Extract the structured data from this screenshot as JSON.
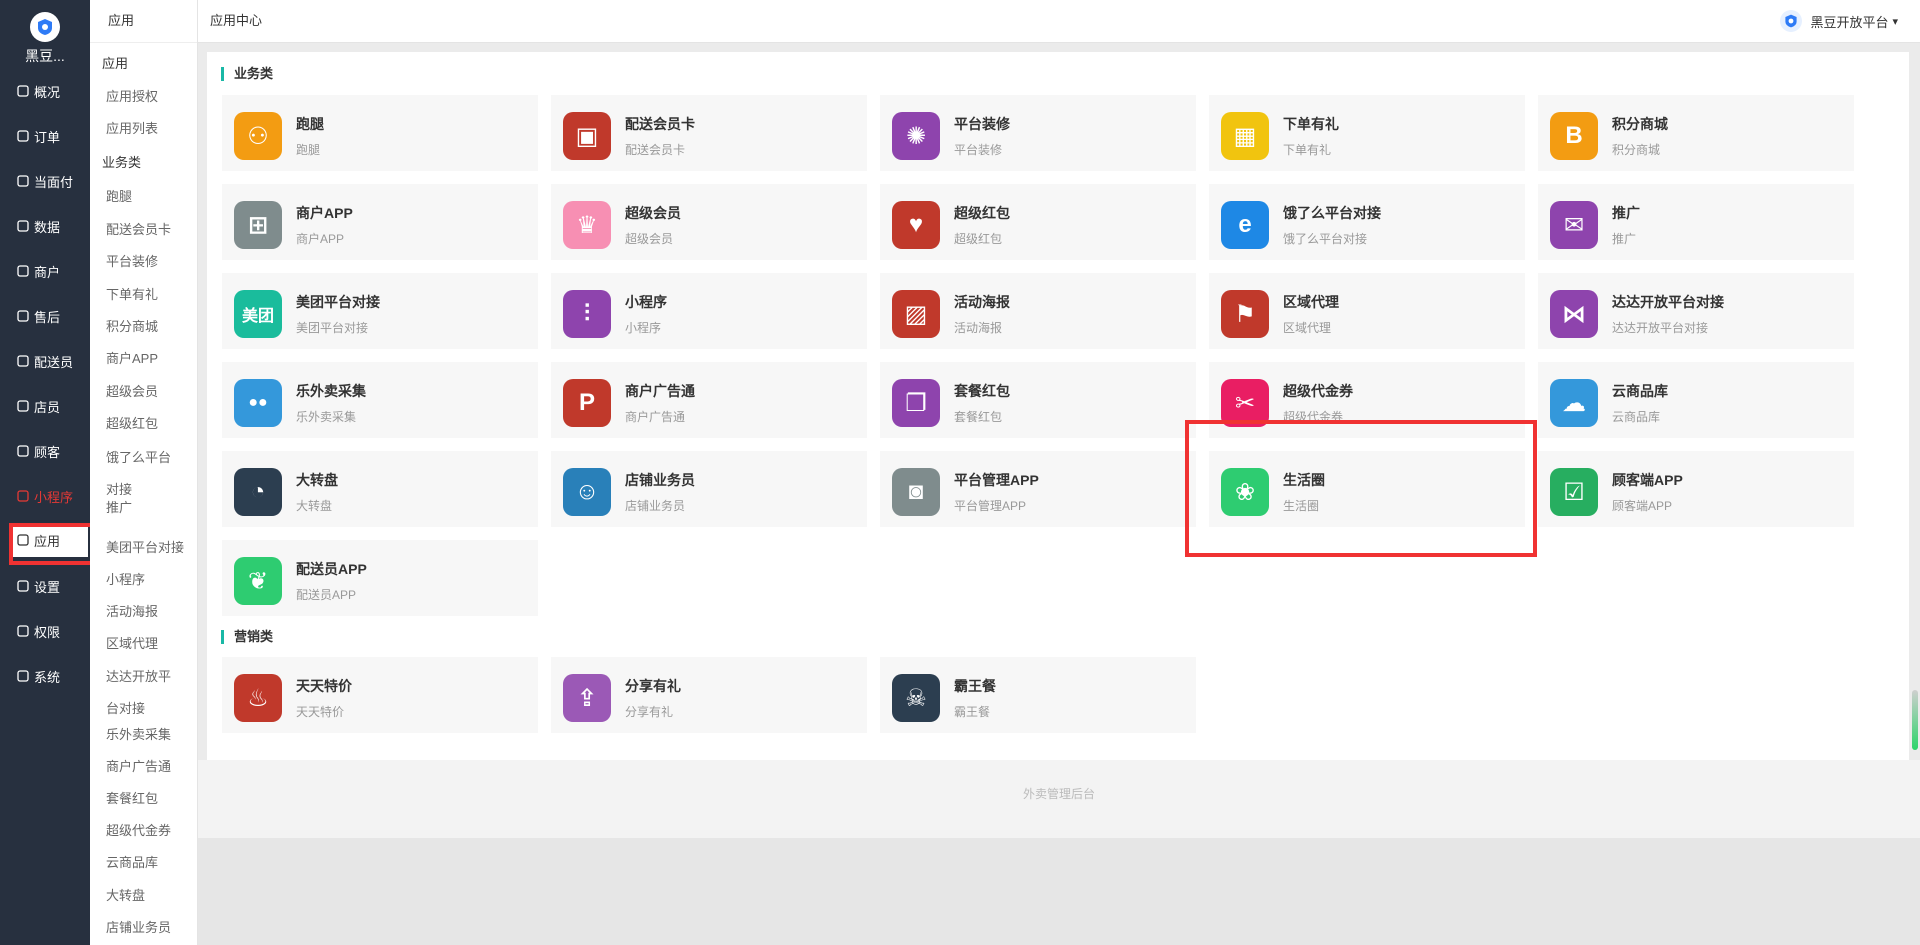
{
  "brand": {
    "name": "黑豆..."
  },
  "nav": [
    {
      "label": "概况",
      "icon": "dashboard-icon"
    },
    {
      "label": "订单",
      "icon": "order-icon"
    },
    {
      "label": "当面付",
      "icon": "pay-icon"
    },
    {
      "label": "数据",
      "icon": "chart-icon"
    },
    {
      "label": "商户",
      "icon": "shop-icon"
    },
    {
      "label": "售后",
      "icon": "aftersale-icon"
    },
    {
      "label": "配送员",
      "icon": "courier-icon"
    },
    {
      "label": "店员",
      "icon": "clerk-icon"
    },
    {
      "label": "顾客",
      "icon": "customer-icon"
    },
    {
      "label": "小程序",
      "icon": "miniprogram-icon"
    },
    {
      "label": "应用",
      "icon": "apps-icon"
    },
    {
      "label": "设置",
      "icon": "gear-icon"
    },
    {
      "label": "权限",
      "icon": "lock-icon"
    },
    {
      "label": "系统",
      "icon": "system-icon"
    }
  ],
  "subnav": {
    "header": "应用",
    "items": [
      {
        "label": "应用",
        "group": true
      },
      {
        "label": "应用授权"
      },
      {
        "label": "应用列表"
      },
      {
        "label": "业务类",
        "group": true
      },
      {
        "label": "跑腿"
      },
      {
        "label": "配送会员卡"
      },
      {
        "label": "平台装修"
      },
      {
        "label": "下单有礼"
      },
      {
        "label": "积分商城"
      },
      {
        "label": "商户APP"
      },
      {
        "label": "超级会员"
      },
      {
        "label": "超级红包"
      },
      {
        "label": "饿了么平台对接"
      },
      {
        "label": "推广"
      },
      {
        "label": "美团平台对接"
      },
      {
        "label": "小程序"
      },
      {
        "label": "活动海报"
      },
      {
        "label": "区域代理"
      },
      {
        "label": "达达开放平台对接"
      },
      {
        "label": "乐外卖采集"
      },
      {
        "label": "商户广告通"
      },
      {
        "label": "套餐红包"
      },
      {
        "label": "超级代金券"
      },
      {
        "label": "云商品库"
      },
      {
        "label": "大转盘"
      },
      {
        "label": "店铺业务员"
      }
    ]
  },
  "header": {
    "title": "应用中心",
    "user": "黑豆开放平台",
    "dropdown_glyph": "▾"
  },
  "sections": [
    {
      "title": "业务类"
    },
    {
      "title": "营销类"
    }
  ],
  "business_apps": [
    {
      "name": "跑腿",
      "desc": "跑腿",
      "color": "#f39c12",
      "icon": "runner-icon",
      "glyph": "⚇"
    },
    {
      "name": "配送会员卡",
      "desc": "配送会员卡",
      "color": "#c0392b",
      "icon": "member-card-icon",
      "glyph": "▣"
    },
    {
      "name": "平台装修",
      "desc": "平台装修",
      "color": "#8e44ad",
      "icon": "palette-icon",
      "glyph": "✺"
    },
    {
      "name": "下单有礼",
      "desc": "下单有礼",
      "color": "#f1c40f",
      "icon": "calendar-icon",
      "glyph": "▦"
    },
    {
      "name": "积分商城",
      "desc": "积分商城",
      "color": "#f39c12",
      "icon": "blogger-icon",
      "glyph": "B"
    },
    {
      "name": "商户APP",
      "desc": "商户APP",
      "color": "#7f8c8d",
      "icon": "windows-icon",
      "glyph": "⊞"
    },
    {
      "name": "超级会员",
      "desc": "超级会员",
      "color": "#f78fb3",
      "icon": "crown-icon",
      "glyph": "♛"
    },
    {
      "name": "超级红包",
      "desc": "超级红包",
      "color": "#c0392b",
      "icon": "heart-icon",
      "glyph": "♥"
    },
    {
      "name": "饿了么平台对接",
      "desc": "饿了么平台对接",
      "color": "#1e88e5",
      "icon": "eleme-icon",
      "glyph": "e"
    },
    {
      "name": "推广",
      "desc": "推广",
      "color": "#8e44ad",
      "icon": "chat-icon",
      "glyph": "✉"
    },
    {
      "name": "美团平台对接",
      "desc": "美团平台对接",
      "color": "#1abc9c",
      "icon": "meituan-icon",
      "glyph": "美团"
    },
    {
      "name": "小程序",
      "desc": "小程序",
      "color": "#8e44ad",
      "icon": "sliders-icon",
      "glyph": "⫶"
    },
    {
      "name": "活动海报",
      "desc": "活动海报",
      "color": "#c0392b",
      "icon": "image-icon",
      "glyph": "▨"
    },
    {
      "name": "区域代理",
      "desc": "区域代理",
      "color": "#c0392b",
      "icon": "flag-icon",
      "glyph": "⚑"
    },
    {
      "name": "达达开放平台对接",
      "desc": "达达开放平台对接",
      "color": "#8e44ad",
      "icon": "visualstudio-icon",
      "glyph": "⋈"
    },
    {
      "name": "乐外卖采集",
      "desc": "乐外卖采集",
      "color": "#3498db",
      "icon": "flickr-icon",
      "glyph": "●●"
    },
    {
      "name": "商户广告通",
      "desc": "商户广告通",
      "color": "#c0392b",
      "icon": "pinterest-icon",
      "glyph": "P"
    },
    {
      "name": "套餐红包",
      "desc": "套餐红包",
      "color": "#8e44ad",
      "icon": "copy-icon",
      "glyph": "❐"
    },
    {
      "name": "超级代金券",
      "desc": "超级代金券",
      "color": "#e91e63",
      "icon": "ticket-icon",
      "glyph": "✂"
    },
    {
      "name": "云商品库",
      "desc": "云商品库",
      "color": "#3498db",
      "icon": "cloud-icon",
      "glyph": "☁"
    },
    {
      "name": "大转盘",
      "desc": "大转盘",
      "color": "#2c3e50",
      "icon": "dashboard-dial-icon",
      "glyph": "◔"
    },
    {
      "name": "店铺业务员",
      "desc": "店铺业务员",
      "color": "#2980b9",
      "icon": "user-icon",
      "glyph": "☺"
    },
    {
      "name": "平台管理APP",
      "desc": "平台管理APP",
      "color": "#7f8c8d",
      "icon": "safe-icon",
      "glyph": "◙"
    },
    {
      "name": "生活圈",
      "desc": "生活圈",
      "color": "#2ecc71",
      "icon": "evernote-icon",
      "glyph": "❀"
    },
    {
      "name": "顾客端APP",
      "desc": "顾客端APP",
      "color": "#27ae60",
      "icon": "check-square-icon",
      "glyph": "☑"
    },
    {
      "name": "配送员APP",
      "desc": "配送员APP",
      "color": "#2ecc71",
      "icon": "leaf-icon",
      "glyph": "❦"
    }
  ],
  "marketing_apps": [
    {
      "name": "天天特价",
      "desc": "天天特价",
      "color": "#c0392b",
      "icon": "fire-icon",
      "glyph": "♨"
    },
    {
      "name": "分享有礼",
      "desc": "分享有礼",
      "color": "#9b59b6",
      "icon": "share-icon",
      "glyph": "⇪"
    },
    {
      "name": "霸王餐",
      "desc": "霸王餐",
      "color": "#2c3e50",
      "icon": "pirate-icon",
      "glyph": "☠"
    }
  ],
  "footer": {
    "text": "外卖管理后台"
  }
}
